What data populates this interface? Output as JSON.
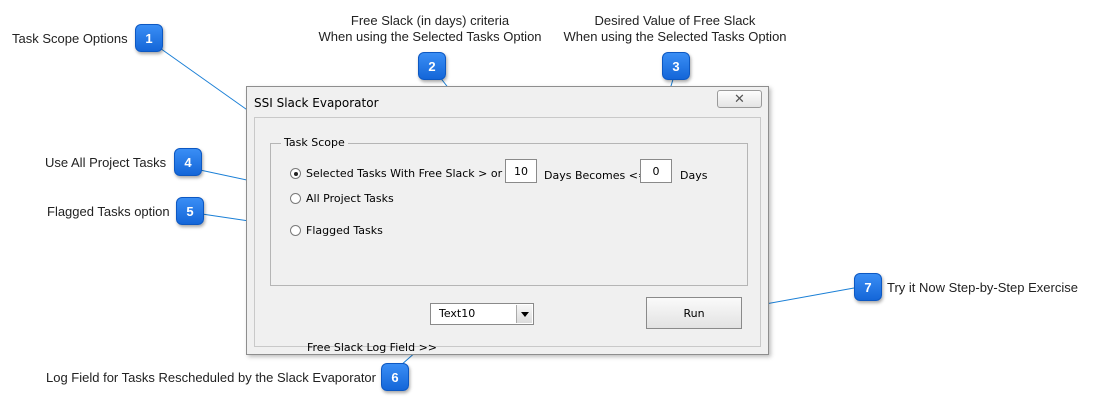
{
  "callouts": {
    "c1": {
      "number": "1",
      "label": "Task Scope Options"
    },
    "c2": {
      "number": "2",
      "line1": "Free Slack (in days) criteria",
      "line2": "When using the Selected Tasks Option"
    },
    "c3": {
      "number": "3",
      "line1": "Desired Value of Free Slack",
      "line2": "When using the Selected Tasks Option"
    },
    "c4": {
      "number": "4",
      "label": "Use All Project Tasks"
    },
    "c5": {
      "number": "5",
      "label": "Flagged Tasks option"
    },
    "c6": {
      "number": "6",
      "label": "Log Field for Tasks Rescheduled by the Slack Evaporator"
    },
    "c7": {
      "number": "7",
      "label": "Try it Now Step-by-Step Exercise"
    }
  },
  "dialog": {
    "title": "SSI Slack Evaporator",
    "close_glyph": "✕",
    "group_title": "Task Scope",
    "options": {
      "selected": {
        "label": "Selected Tasks With Free Slack > or =",
        "checked": true
      },
      "all": {
        "label": "All Project Tasks",
        "checked": false
      },
      "flagged": {
        "label": "Flagged Tasks",
        "checked": false
      }
    },
    "slack_value": "10",
    "days_becomes_label": "Days Becomes <=",
    "desired_value": "0",
    "days_label": "Days",
    "log_field_label": "Free Slack Log Field >>",
    "log_field_value": "Text10",
    "run_label": "Run"
  },
  "colors": {
    "badge": "#1b72e8",
    "connector": "#1a7fd6"
  }
}
